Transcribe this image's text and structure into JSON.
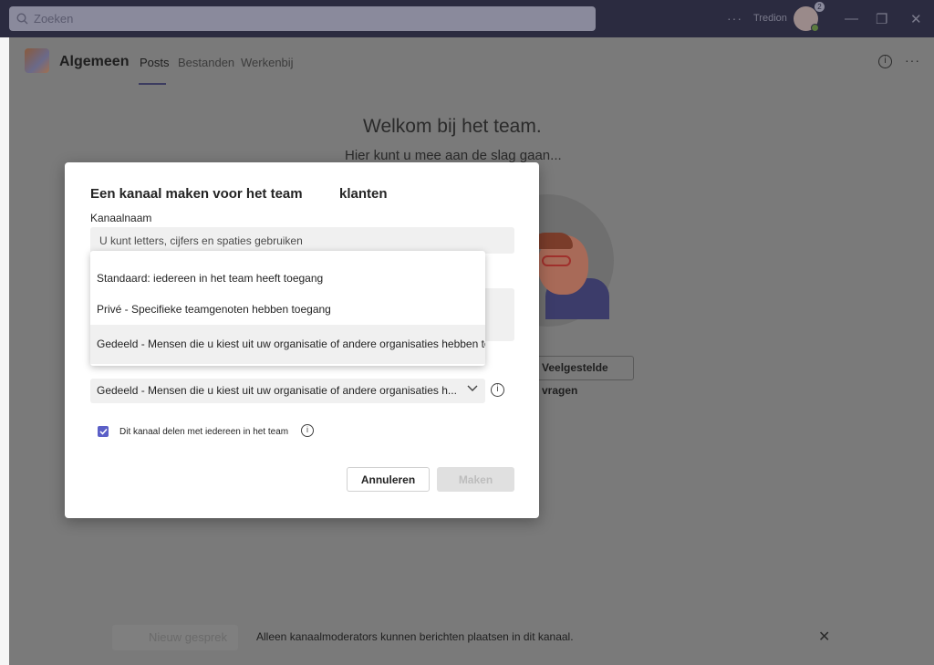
{
  "titlebar": {
    "search_placeholder": "Zoeken",
    "more_label": "···",
    "user_name": "Tredion",
    "notification_count": "2",
    "window_minimize": "—",
    "window_restore": "❐",
    "window_close": "✕"
  },
  "header": {
    "channel_title": "Algemeen",
    "tabs": [
      {
        "label": "Posts"
      },
      {
        "label": "Bestanden"
      },
      {
        "label": "Werkenbij"
      }
    ],
    "info_icon": "i",
    "more_label": "···"
  },
  "welcome": {
    "title": "Welkom bij het team.",
    "subtitle": "Hier kunt u mee aan de slag gaan...",
    "faq_button": "Veelgestelde vragen"
  },
  "bottom": {
    "new_conversation": "Nieuw gesprek",
    "notice": "Alleen kanaalmoderators kunnen berichten plaatsen in dit kanaal.",
    "close": "✕"
  },
  "dialog": {
    "title": "Een kanaal maken voor het team",
    "team_name": "klanten",
    "name_label": "Kanaalnaam",
    "name_placeholder": "U kunt letters, cijfers en spaties gebruiken",
    "options": [
      {
        "label": "Standaard: iedereen in het team heeft toegang"
      },
      {
        "label": "Privé - Specifieke teamgenoten hebben toegang"
      },
      {
        "label": "Gedeeld - Mensen die u kiest uit uw organisatie of andere organisaties hebben toegang"
      }
    ],
    "selected_value": "Gedeeld - Mensen die u kiest uit uw organisatie of andere organisaties h...",
    "info_icon": "i",
    "share_checkbox_label": "Dit kanaal delen met iedereen in het team",
    "share_checked": true,
    "cancel_label": "Annuleren",
    "create_label": "Maken"
  },
  "colors": {
    "accent": "#5b5fc7",
    "titlebar": "#2b2b40"
  }
}
